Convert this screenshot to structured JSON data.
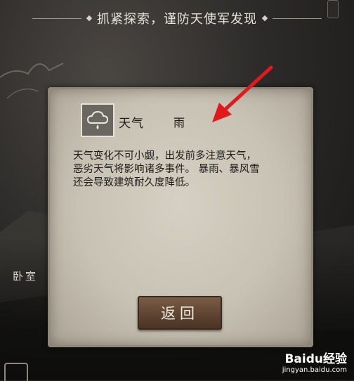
{
  "banner": {
    "text": "抓紧探索，谨防天使军发现"
  },
  "background": {
    "room_label": "卧室"
  },
  "dialog": {
    "weather_title": "天气",
    "weather_value": "雨",
    "description_lines": [
      "天气变化不可小觑，出发前多注意天气，",
      "恶劣天气将影响诸多事件。 暴雨、暴风雪",
      "还会导致建筑耐久度降低。"
    ],
    "back_label": "返回",
    "weather_icon": "rain-cloud-icon"
  },
  "annotation": {
    "arrow_color": "#e0191c"
  },
  "watermark": {
    "logo": "Baidu经验",
    "url": "jingyan.baidu.com"
  }
}
